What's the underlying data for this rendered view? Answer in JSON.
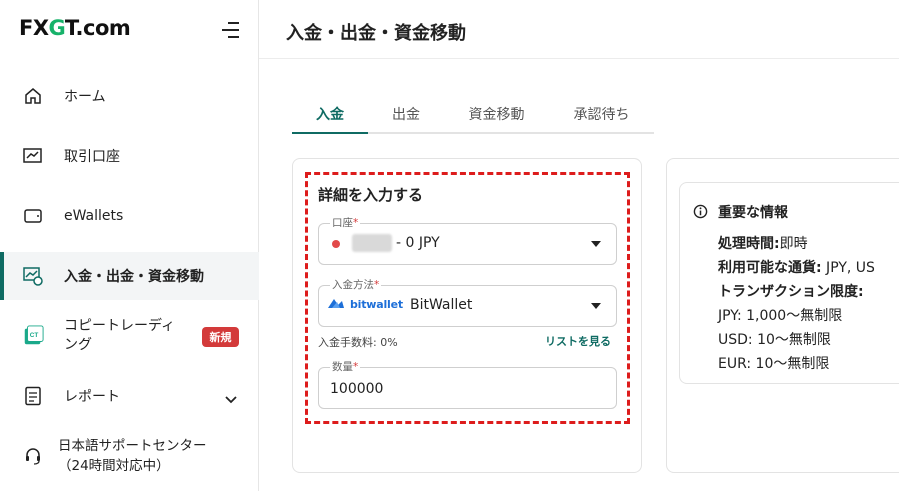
{
  "brand": {
    "prefix": "FX",
    "accent": "G",
    "suffix": "T.com"
  },
  "sidebar": {
    "items": [
      {
        "label": "ホーム",
        "icon": "home-icon"
      },
      {
        "label": "取引口座",
        "icon": "trading-account-icon"
      },
      {
        "label": "eWallets",
        "icon": "wallet-icon"
      },
      {
        "label": "入金・出金・資金移動",
        "icon": "deposit-withdraw-icon",
        "active": true
      },
      {
        "label_line1": "コピートレーディ",
        "label_line2": "ング",
        "icon": "copy-trading-icon",
        "badge": "新規"
      },
      {
        "label": "レポート",
        "icon": "report-icon"
      },
      {
        "label_line1": "日本語サポートセンター",
        "label_line2": "（24時間対応中）",
        "icon": "support-headset-icon"
      }
    ]
  },
  "header": {
    "title": "入金・出金・資金移動"
  },
  "tabs": [
    {
      "label": "入金",
      "active": true
    },
    {
      "label": "出金"
    },
    {
      "label": "資金移動"
    },
    {
      "label": "承認待ち"
    }
  ],
  "form": {
    "title": "詳細を入力する",
    "account": {
      "label": "口座",
      "required_mark": "*",
      "value": "- 0 JPY"
    },
    "method": {
      "label": "入金方法",
      "required_mark": "*",
      "logo_text": "bitwallet",
      "value": "BitWallet"
    },
    "fee": "入金手数料: 0%",
    "list_link": "リストを見る",
    "quantity": {
      "label": "数量",
      "required_mark": "*",
      "value": "100000"
    }
  },
  "info": {
    "title": "重要な情報",
    "processing_label": "処理時間:",
    "processing_value": "即時",
    "currencies_label": "利用可能な通貨:",
    "currencies_value": " JPY, US",
    "limits_label": "トランザクション限度:",
    "limits": [
      "JPY: 1,000〜無制限",
      "USD: 10〜無制限",
      "EUR: 10〜無制限"
    ]
  },
  "colors": {
    "accent": "#0f6b63",
    "brand_green": "#17b26a",
    "highlight_dash": "#dd1c1c",
    "badge": "#d33a3a"
  }
}
